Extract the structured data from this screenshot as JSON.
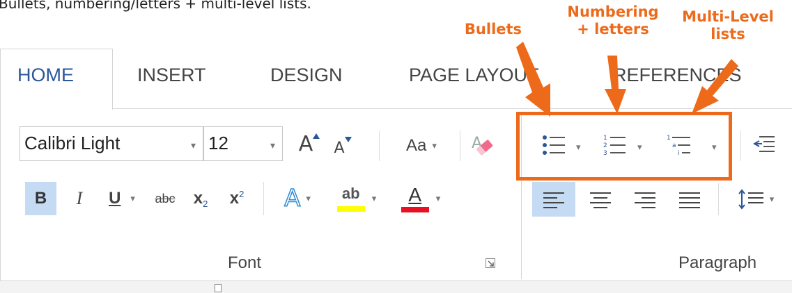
{
  "caption": "Bullets, numbering/letters + multi-level lists.",
  "callouts": {
    "bullets": "Bullets",
    "numbering_line1": "Numbering",
    "numbering_line2": "+ letters",
    "multilevel_line1": "Multi-Level",
    "multilevel_line2": "lists"
  },
  "tabs": [
    {
      "label": "HOME",
      "active": true
    },
    {
      "label": "INSERT"
    },
    {
      "label": "DESIGN"
    },
    {
      "label": "PAGE LAYOUT"
    },
    {
      "label": "REFERENCES"
    }
  ],
  "font_group": {
    "font_name": "Calibri Light",
    "font_size": "12",
    "grow_font": "A",
    "shrink_font": "A",
    "change_case": "Aa",
    "bold": "B",
    "italic": "I",
    "underline": "U",
    "strikethrough": "abc",
    "subscript": "x",
    "subscript_mark": "2",
    "superscript": "x",
    "superscript_mark": "2",
    "text_effects": "A",
    "highlight": "ab",
    "font_color": "A",
    "label": "Font"
  },
  "paragraph_group": {
    "label": "Paragraph"
  },
  "colors": {
    "accent": "#ec6a1a",
    "tab_active_text": "#2b579a",
    "highlight_yellow": "#ffff00",
    "font_color_red": "#e81123",
    "pressed_bg": "#c5dbf4"
  }
}
